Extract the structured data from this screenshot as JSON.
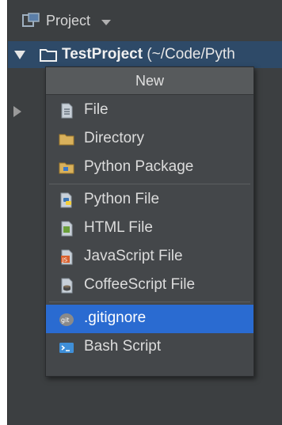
{
  "header": {
    "label": "Project"
  },
  "tree": {
    "project_name": "TestProject",
    "project_path": " (~/Code/Pyth"
  },
  "menu": {
    "title": "New",
    "items": [
      {
        "label": "File",
        "icon": "file-icon"
      },
      {
        "label": "Directory",
        "icon": "folder-icon"
      },
      {
        "label": "Python Package",
        "icon": "package-icon"
      },
      {
        "label": "Python File",
        "icon": "python-file-icon"
      },
      {
        "label": "HTML File",
        "icon": "html-file-icon"
      },
      {
        "label": "JavaScript File",
        "icon": "javascript-file-icon"
      },
      {
        "label": "CoffeeScript File",
        "icon": "coffeescript-file-icon"
      },
      {
        "label": ".gitignore",
        "icon": "git-icon",
        "selected": true
      },
      {
        "label": "Bash Script",
        "icon": "terminal-icon"
      }
    ]
  },
  "colors": {
    "selection": "#2a6bd1",
    "tree_highlight": "#2e4a68",
    "background": "#3c3f41"
  }
}
